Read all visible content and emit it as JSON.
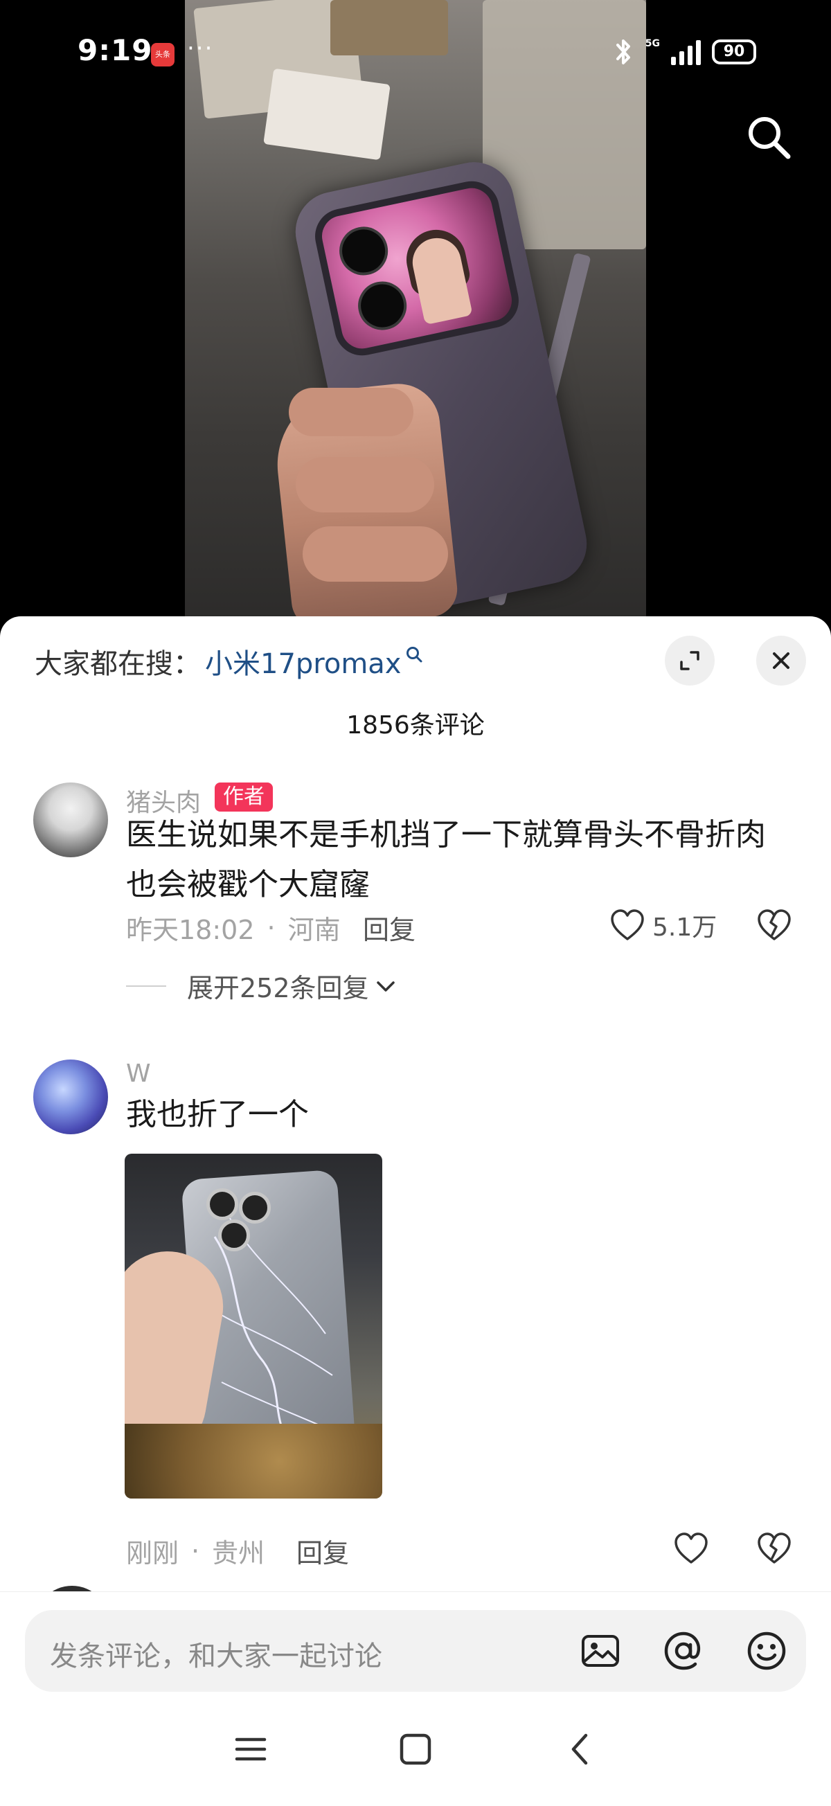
{
  "status_bar": {
    "time": "9:19",
    "app_badge": "头条",
    "overflow": "···",
    "network": "5G",
    "battery": "90"
  },
  "sheet": {
    "search_prefix": "大家都在搜：",
    "search_term": "小米17promax",
    "comment_count": "1856条评论"
  },
  "comments": [
    {
      "author": "猪头肉",
      "tag": "作者",
      "text_line1": "医生说如果不是手机挡了一下就算骨头不骨折肉",
      "text_line2": "也会被戳个大窟窿",
      "time": "昨天18:02",
      "location": "河南",
      "reply_label": "回复",
      "likes": "5.1万",
      "expand_label": "展开252条回复"
    },
    {
      "author": "W",
      "text": "我也折了一个",
      "time": "刚刚",
      "location": "贵州",
      "reply_label": "回复"
    }
  ],
  "input": {
    "placeholder": "发条评论，和大家一起讨论"
  },
  "icons": {
    "search": "search-icon",
    "expand": "expand-icon",
    "close": "close-icon",
    "like": "heart-icon",
    "dislike": "broken-heart-icon",
    "image": "image-icon",
    "mention": "at-icon",
    "emoji": "emoji-icon",
    "menu": "menu-icon",
    "home": "home-icon",
    "back": "back-icon"
  }
}
